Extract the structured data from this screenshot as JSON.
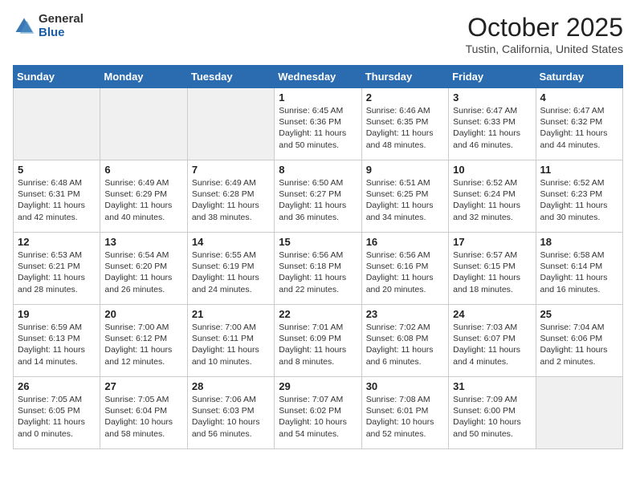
{
  "header": {
    "logo_general": "General",
    "logo_blue": "Blue",
    "month_title": "October 2025",
    "location": "Tustin, California, United States"
  },
  "weekdays": [
    "Sunday",
    "Monday",
    "Tuesday",
    "Wednesday",
    "Thursday",
    "Friday",
    "Saturday"
  ],
  "weeks": [
    [
      {
        "day": "",
        "text": "",
        "empty": true
      },
      {
        "day": "",
        "text": "",
        "empty": true
      },
      {
        "day": "",
        "text": "",
        "empty": true
      },
      {
        "day": "1",
        "text": "Sunrise: 6:45 AM\nSunset: 6:36 PM\nDaylight: 11 hours\nand 50 minutes.",
        "empty": false
      },
      {
        "day": "2",
        "text": "Sunrise: 6:46 AM\nSunset: 6:35 PM\nDaylight: 11 hours\nand 48 minutes.",
        "empty": false
      },
      {
        "day": "3",
        "text": "Sunrise: 6:47 AM\nSunset: 6:33 PM\nDaylight: 11 hours\nand 46 minutes.",
        "empty": false
      },
      {
        "day": "4",
        "text": "Sunrise: 6:47 AM\nSunset: 6:32 PM\nDaylight: 11 hours\nand 44 minutes.",
        "empty": false
      }
    ],
    [
      {
        "day": "5",
        "text": "Sunrise: 6:48 AM\nSunset: 6:31 PM\nDaylight: 11 hours\nand 42 minutes.",
        "empty": false
      },
      {
        "day": "6",
        "text": "Sunrise: 6:49 AM\nSunset: 6:29 PM\nDaylight: 11 hours\nand 40 minutes.",
        "empty": false
      },
      {
        "day": "7",
        "text": "Sunrise: 6:49 AM\nSunset: 6:28 PM\nDaylight: 11 hours\nand 38 minutes.",
        "empty": false
      },
      {
        "day": "8",
        "text": "Sunrise: 6:50 AM\nSunset: 6:27 PM\nDaylight: 11 hours\nand 36 minutes.",
        "empty": false
      },
      {
        "day": "9",
        "text": "Sunrise: 6:51 AM\nSunset: 6:25 PM\nDaylight: 11 hours\nand 34 minutes.",
        "empty": false
      },
      {
        "day": "10",
        "text": "Sunrise: 6:52 AM\nSunset: 6:24 PM\nDaylight: 11 hours\nand 32 minutes.",
        "empty": false
      },
      {
        "day": "11",
        "text": "Sunrise: 6:52 AM\nSunset: 6:23 PM\nDaylight: 11 hours\nand 30 minutes.",
        "empty": false
      }
    ],
    [
      {
        "day": "12",
        "text": "Sunrise: 6:53 AM\nSunset: 6:21 PM\nDaylight: 11 hours\nand 28 minutes.",
        "empty": false
      },
      {
        "day": "13",
        "text": "Sunrise: 6:54 AM\nSunset: 6:20 PM\nDaylight: 11 hours\nand 26 minutes.",
        "empty": false
      },
      {
        "day": "14",
        "text": "Sunrise: 6:55 AM\nSunset: 6:19 PM\nDaylight: 11 hours\nand 24 minutes.",
        "empty": false
      },
      {
        "day": "15",
        "text": "Sunrise: 6:56 AM\nSunset: 6:18 PM\nDaylight: 11 hours\nand 22 minutes.",
        "empty": false
      },
      {
        "day": "16",
        "text": "Sunrise: 6:56 AM\nSunset: 6:16 PM\nDaylight: 11 hours\nand 20 minutes.",
        "empty": false
      },
      {
        "day": "17",
        "text": "Sunrise: 6:57 AM\nSunset: 6:15 PM\nDaylight: 11 hours\nand 18 minutes.",
        "empty": false
      },
      {
        "day": "18",
        "text": "Sunrise: 6:58 AM\nSunset: 6:14 PM\nDaylight: 11 hours\nand 16 minutes.",
        "empty": false
      }
    ],
    [
      {
        "day": "19",
        "text": "Sunrise: 6:59 AM\nSunset: 6:13 PM\nDaylight: 11 hours\nand 14 minutes.",
        "empty": false
      },
      {
        "day": "20",
        "text": "Sunrise: 7:00 AM\nSunset: 6:12 PM\nDaylight: 11 hours\nand 12 minutes.",
        "empty": false
      },
      {
        "day": "21",
        "text": "Sunrise: 7:00 AM\nSunset: 6:11 PM\nDaylight: 11 hours\nand 10 minutes.",
        "empty": false
      },
      {
        "day": "22",
        "text": "Sunrise: 7:01 AM\nSunset: 6:09 PM\nDaylight: 11 hours\nand 8 minutes.",
        "empty": false
      },
      {
        "day": "23",
        "text": "Sunrise: 7:02 AM\nSunset: 6:08 PM\nDaylight: 11 hours\nand 6 minutes.",
        "empty": false
      },
      {
        "day": "24",
        "text": "Sunrise: 7:03 AM\nSunset: 6:07 PM\nDaylight: 11 hours\nand 4 minutes.",
        "empty": false
      },
      {
        "day": "25",
        "text": "Sunrise: 7:04 AM\nSunset: 6:06 PM\nDaylight: 11 hours\nand 2 minutes.",
        "empty": false
      }
    ],
    [
      {
        "day": "26",
        "text": "Sunrise: 7:05 AM\nSunset: 6:05 PM\nDaylight: 11 hours\nand 0 minutes.",
        "empty": false
      },
      {
        "day": "27",
        "text": "Sunrise: 7:05 AM\nSunset: 6:04 PM\nDaylight: 10 hours\nand 58 minutes.",
        "empty": false
      },
      {
        "day": "28",
        "text": "Sunrise: 7:06 AM\nSunset: 6:03 PM\nDaylight: 10 hours\nand 56 minutes.",
        "empty": false
      },
      {
        "day": "29",
        "text": "Sunrise: 7:07 AM\nSunset: 6:02 PM\nDaylight: 10 hours\nand 54 minutes.",
        "empty": false
      },
      {
        "day": "30",
        "text": "Sunrise: 7:08 AM\nSunset: 6:01 PM\nDaylight: 10 hours\nand 52 minutes.",
        "empty": false
      },
      {
        "day": "31",
        "text": "Sunrise: 7:09 AM\nSunset: 6:00 PM\nDaylight: 10 hours\nand 50 minutes.",
        "empty": false
      },
      {
        "day": "",
        "text": "",
        "empty": true
      }
    ]
  ]
}
